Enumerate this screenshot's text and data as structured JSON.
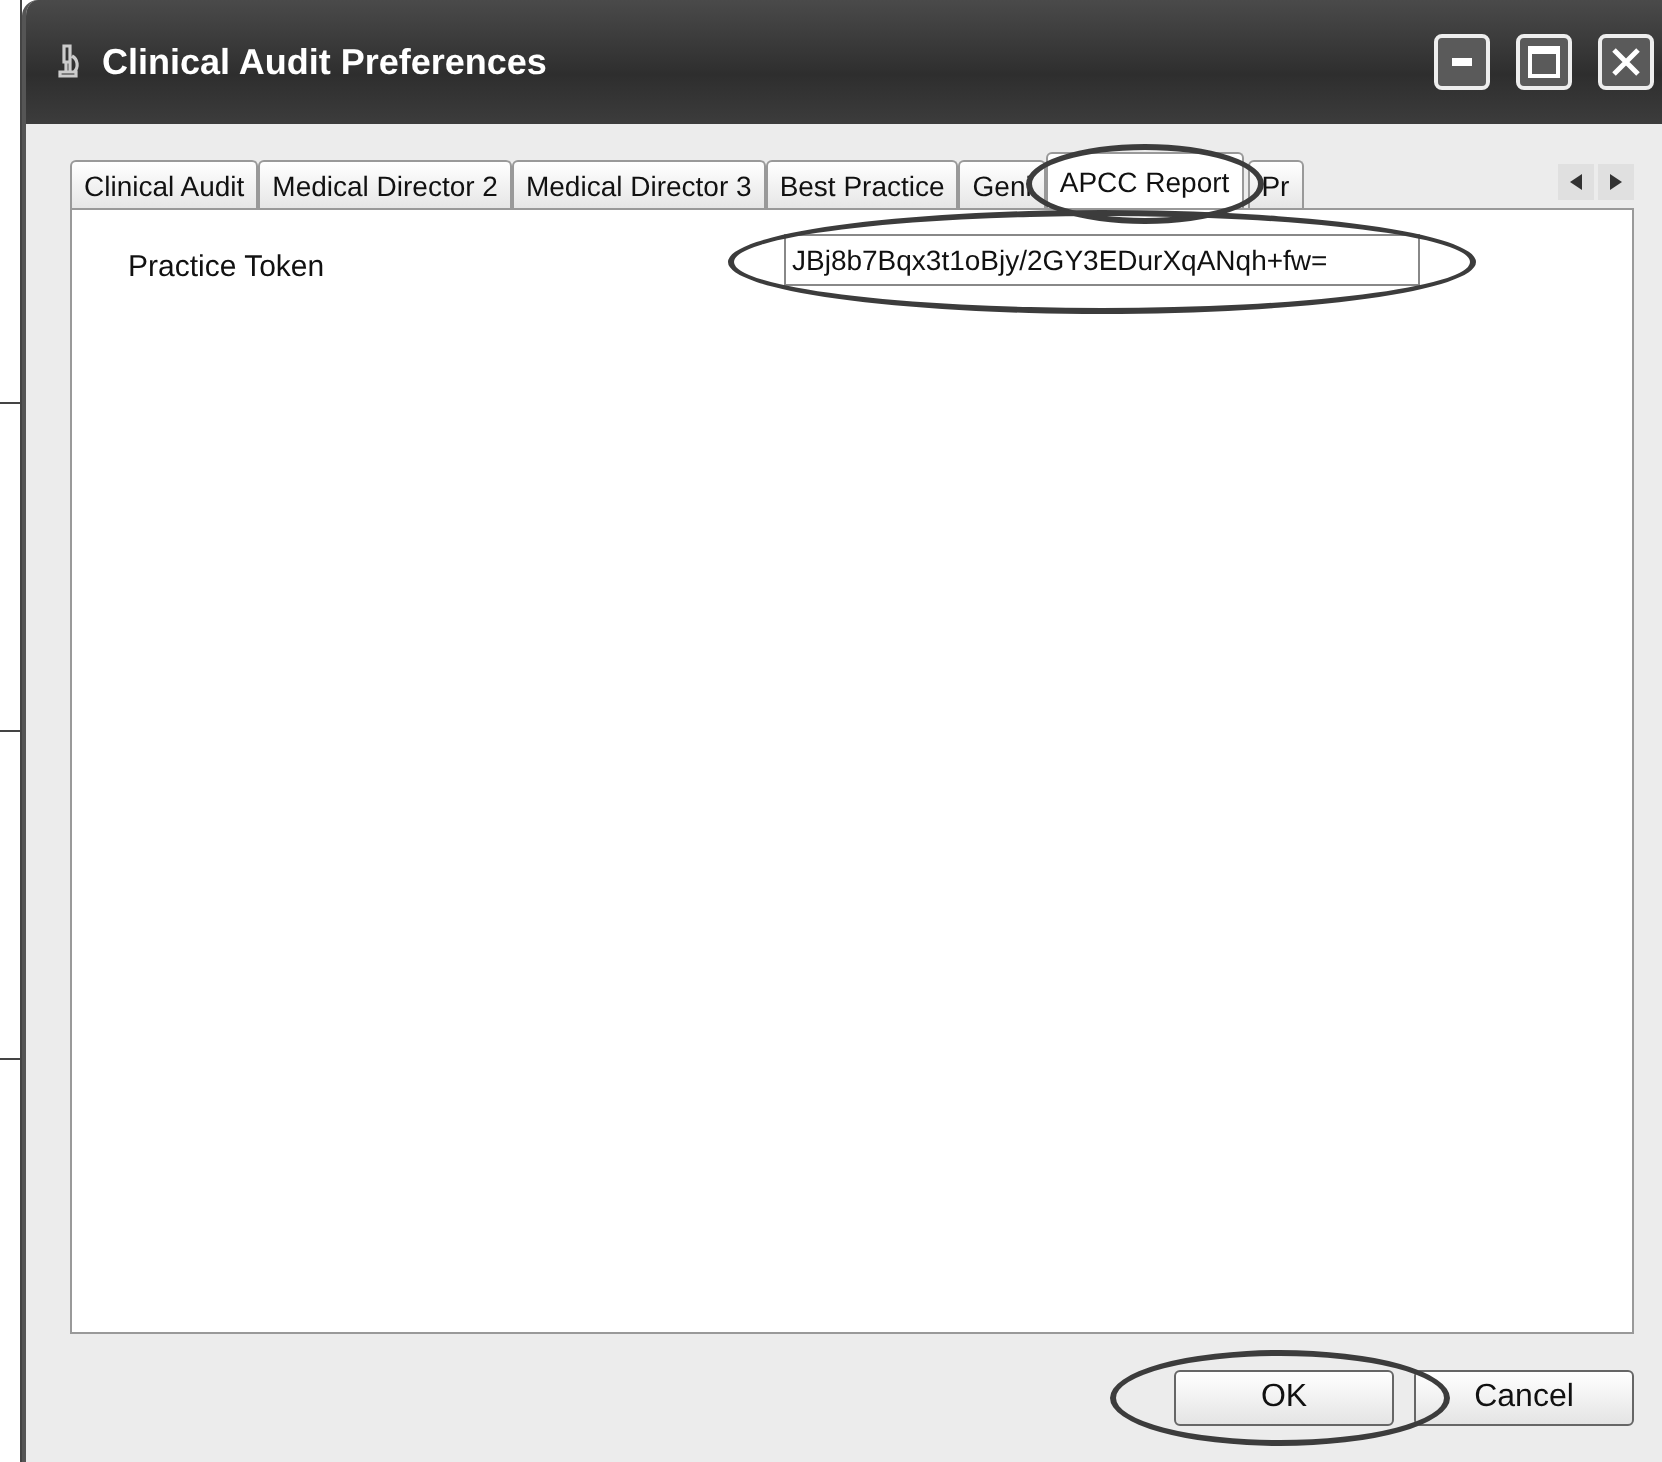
{
  "window": {
    "title": "Clinical Audit Preferences"
  },
  "tabs": [
    {
      "label": "Clinical Audit",
      "selected": false,
      "highlighted": false
    },
    {
      "label": "Medical Director 2",
      "selected": false,
      "highlighted": false
    },
    {
      "label": "Medical Director 3",
      "selected": false,
      "highlighted": false
    },
    {
      "label": "Best Practice",
      "selected": false,
      "highlighted": false
    },
    {
      "label": "Geni",
      "selected": false,
      "highlighted": false
    },
    {
      "label": "APCC Report",
      "selected": true,
      "highlighted": true
    },
    {
      "label": "Pr",
      "selected": false,
      "highlighted": false
    }
  ],
  "practice_token": {
    "label": "Practice Token",
    "value": "JBj8b7Bqx3t1oBjy/2GY3EDurXqANqh+fw=",
    "highlighted": true
  },
  "buttons": [
    {
      "label": "OK",
      "highlighted": true
    },
    {
      "label": "Cancel",
      "highlighted": false
    }
  ]
}
